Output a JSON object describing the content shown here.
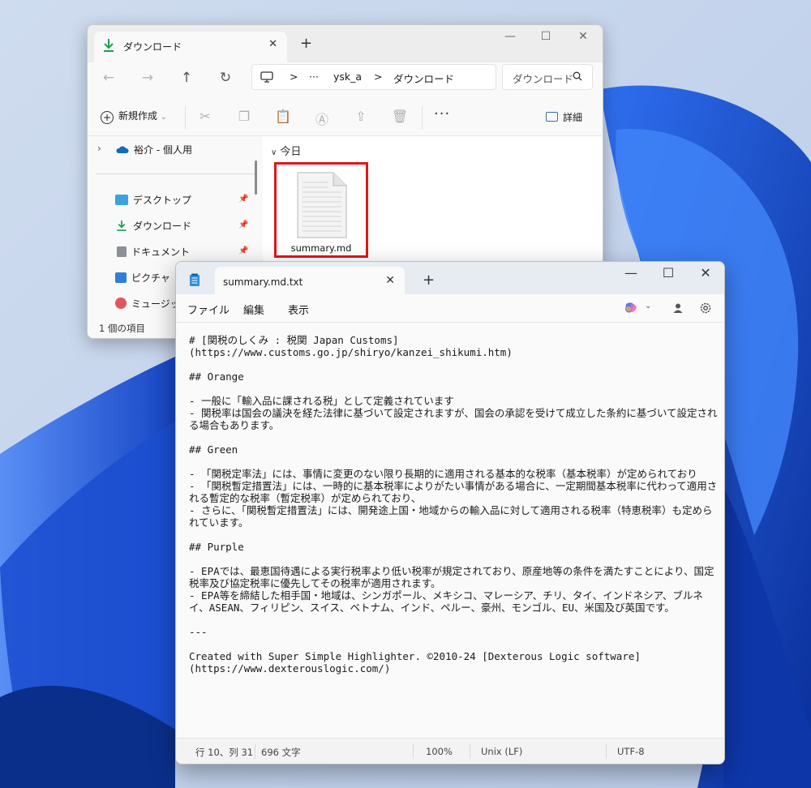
{
  "explorer": {
    "tab_title": "ダウンロード",
    "new_tab": "+",
    "window_controls": {
      "minimize": "—",
      "maximize": "☐",
      "close": "✕"
    },
    "tab_close": "✕",
    "nav": {
      "back": "←",
      "forward": "→",
      "up": "↑",
      "refresh": "↻"
    },
    "breadcrumb": {
      "ellipsis": "···",
      "user": "ysk_a",
      "folder": "ダウンロード",
      "separator": ">"
    },
    "search_placeholder": "ダウンロード",
    "toolbar": {
      "new_label": "新規作成",
      "more": "···",
      "details_label": "詳細"
    },
    "sidebar": {
      "cloud": "裕介 - 個人用",
      "items": [
        {
          "label": "デスクトップ",
          "icon": "desktop-icon"
        },
        {
          "label": "ダウンロード",
          "icon": "download-icon"
        },
        {
          "label": "ドキュメント",
          "icon": "document-icon"
        },
        {
          "label": "ピクチャ",
          "icon": "picture-icon"
        },
        {
          "label": "ミュージック",
          "icon": "music-icon"
        }
      ]
    },
    "group_header": "今日",
    "file": {
      "name": "summary.md",
      "highlight_color": "#e0161b"
    },
    "status": "1 個の項目"
  },
  "notepad": {
    "tab_title": "summary.md.txt",
    "tab_close": "✕",
    "new_tab": "+",
    "window_controls": {
      "minimize": "—",
      "maximize": "☐",
      "close": "✕"
    },
    "menu": {
      "file": "ファイル",
      "edit": "編集",
      "view": "表示"
    },
    "content": "# [関税のしくみ : 税関 Japan Customs]\n(https://www.customs.go.jp/shiryo/kanzei_shikumi.htm)\n\n## Orange\n\n- 一般に「輸入品に課される税」として定義されています\n- 関税率は国会の議決を経た法律に基づいて設定されますが、国会の承認を受けて成立した条約に基づいて設定される場合もあります。\n\n## Green\n\n- 「関税定率法」には、事情に変更のない限り長期的に適用される基本的な税率（基本税率）が定められており\n- 「関税暫定措置法」には、一時的に基本税率によりがたい事情がある場合に、一定期間基本税率に代わって適用される暫定的な税率（暫定税率）が定められており、\n- さらに、「関税暫定措置法」には、開発途上国・地域からの輸入品に対して適用される税率（特恵税率）も定められています。\n\n## Purple\n\n- EPAでは、最恵国待遇による実行税率より低い税率が規定されており、原産地等の条件を満たすことにより、国定税率及び協定税率に優先してその税率が適用されます。\n- EPA等を締結した相手国・地域は、シンガポール、メキシコ、マレーシア、チリ、タイ、インドネシア、ブルネイ、ASEAN、フィリピン、スイス、ベトナム、インド、ペルー、豪州、モンゴル、EU、米国及び英国です。\n\n---\n\nCreated with Super Simple Highlighter. ©2010-24 [Dexterous Logic software]\n(https://www.dexterouslogic.com/)",
    "status": {
      "position": "行 10、列 31",
      "chars": "696 文字",
      "zoom": "100%",
      "line_ending": "Unix (LF)",
      "encoding": "UTF-8"
    }
  },
  "colors": {
    "accent": "#0067c0",
    "highlight": "#e0161b"
  }
}
